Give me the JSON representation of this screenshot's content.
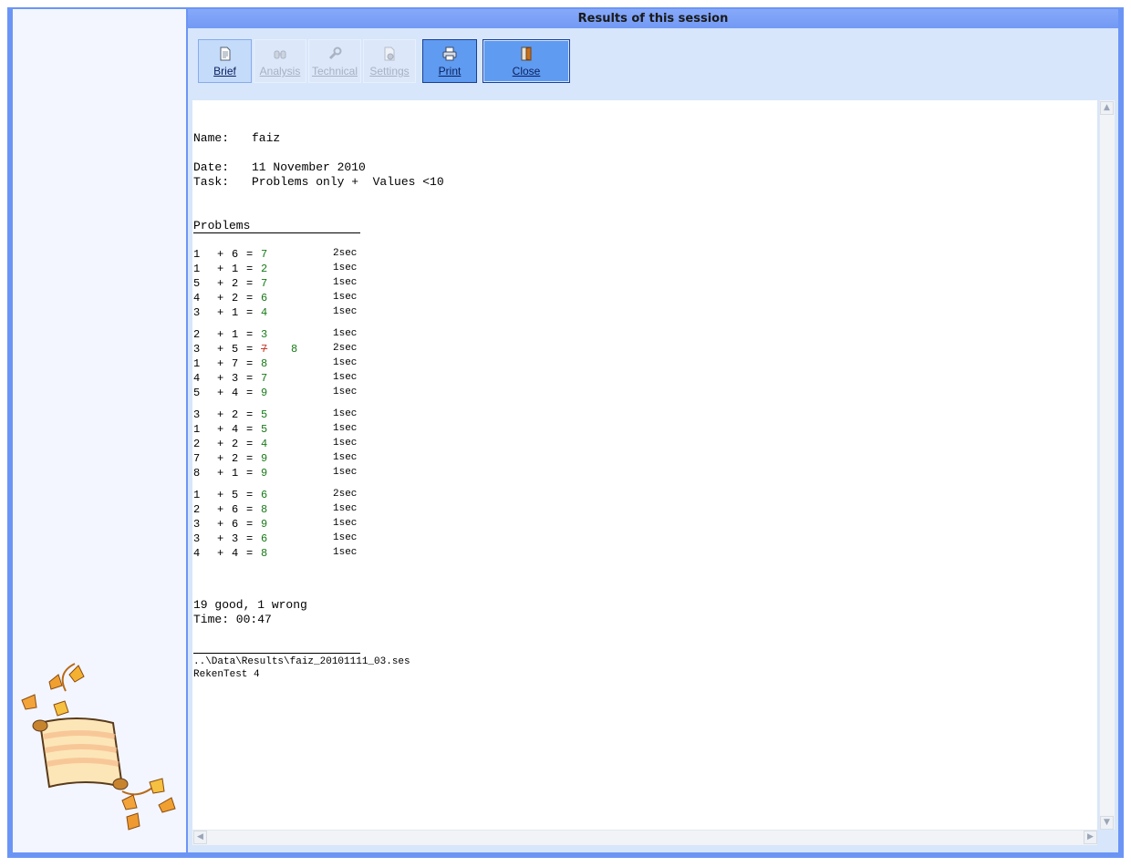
{
  "window": {
    "title": "Results of this session"
  },
  "toolbar": {
    "brief": "Brief",
    "analysis": "Analysis",
    "technical": "Technical",
    "settings": "Settings",
    "print": "Print",
    "close": "Close"
  },
  "report": {
    "name_label": "Name:",
    "name_value": "faiz",
    "date_label": "Date:",
    "date_value": "11 November 2010",
    "task_label": "Task:",
    "task_value": "Problems only +  Values <10",
    "problems_heading": "Problems",
    "groups": [
      [
        {
          "a": "1",
          "op": "+",
          "b": "6",
          "answer": "7",
          "time": "2sec"
        },
        {
          "a": "1",
          "op": "+",
          "b": "1",
          "answer": "2",
          "time": "1sec"
        },
        {
          "a": "5",
          "op": "+",
          "b": "2",
          "answer": "7",
          "time": "1sec"
        },
        {
          "a": "4",
          "op": "+",
          "b": "2",
          "answer": "6",
          "time": "1sec"
        },
        {
          "a": "3",
          "op": "+",
          "b": "1",
          "answer": "4",
          "time": "1sec"
        }
      ],
      [
        {
          "a": "2",
          "op": "+",
          "b": "1",
          "answer": "3",
          "time": "1sec"
        },
        {
          "a": "3",
          "op": "+",
          "b": "5",
          "answer": "7",
          "wrong": true,
          "correction": "8",
          "time": "2sec"
        },
        {
          "a": "1",
          "op": "+",
          "b": "7",
          "answer": "8",
          "time": "1sec"
        },
        {
          "a": "4",
          "op": "+",
          "b": "3",
          "answer": "7",
          "time": "1sec"
        },
        {
          "a": "5",
          "op": "+",
          "b": "4",
          "answer": "9",
          "time": "1sec"
        }
      ],
      [
        {
          "a": "3",
          "op": "+",
          "b": "2",
          "answer": "5",
          "time": "1sec"
        },
        {
          "a": "1",
          "op": "+",
          "b": "4",
          "answer": "5",
          "time": "1sec"
        },
        {
          "a": "2",
          "op": "+",
          "b": "2",
          "answer": "4",
          "time": "1sec"
        },
        {
          "a": "7",
          "op": "+",
          "b": "2",
          "answer": "9",
          "time": "1sec"
        },
        {
          "a": "8",
          "op": "+",
          "b": "1",
          "answer": "9",
          "time": "1sec"
        }
      ],
      [
        {
          "a": "1",
          "op": "+",
          "b": "5",
          "answer": "6",
          "time": "2sec"
        },
        {
          "a": "2",
          "op": "+",
          "b": "6",
          "answer": "8",
          "time": "1sec"
        },
        {
          "a": "3",
          "op": "+",
          "b": "6",
          "answer": "9",
          "time": "1sec"
        },
        {
          "a": "3",
          "op": "+",
          "b": "3",
          "answer": "6",
          "time": "1sec"
        },
        {
          "a": "4",
          "op": "+",
          "b": "4",
          "answer": "8",
          "time": "1sec"
        }
      ]
    ],
    "summary": "19 good, 1 wrong",
    "time_summary": "Time: 00:47",
    "file_path": "..\\Data\\Results\\faiz_20101111_03.ses",
    "program": "RekenTest 4"
  },
  "colors": {
    "frame": "#6b95f5",
    "toolbar_bg": "#d7e6fb",
    "correct": "#177a17",
    "wrong": "#c43c2c"
  },
  "icons": {
    "brief": "document-icon",
    "analysis": "binoculars-icon",
    "technical": "wrench-icon",
    "settings": "gear-icon",
    "print": "printer-icon",
    "close": "door-exit-icon",
    "logo": "parchment-scroll-autumn-leaves-icon"
  }
}
